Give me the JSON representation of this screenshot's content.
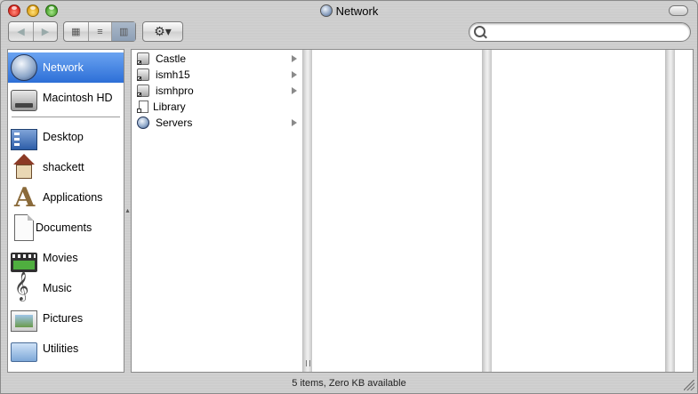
{
  "window": {
    "title": "Network"
  },
  "toolbar": {
    "back_glyph": "◀",
    "forward_glyph": "▶",
    "view_icon_glyph": "▦",
    "view_list_glyph": "≡",
    "view_column_glyph": "▥",
    "action_glyph": "⚙▾",
    "search_placeholder": ""
  },
  "sidebar": {
    "items": [
      {
        "label": "Network",
        "icon": "network-globe-icon",
        "selected": true
      },
      {
        "label": "Macintosh HD",
        "icon": "hard-drive-icon"
      },
      {
        "label": "Desktop",
        "icon": "desktop-icon"
      },
      {
        "label": "shackett",
        "icon": "home-icon"
      },
      {
        "label": "Applications",
        "icon": "applications-icon"
      },
      {
        "label": "Documents",
        "icon": "documents-icon"
      },
      {
        "label": "Movies",
        "icon": "movies-icon"
      },
      {
        "label": "Music",
        "icon": "music-icon"
      },
      {
        "label": "Pictures",
        "icon": "pictures-icon"
      },
      {
        "label": "Utilities",
        "icon": "utilities-icon"
      }
    ]
  },
  "browser": {
    "column1": [
      {
        "label": "Castle",
        "icon": "server-alias-icon",
        "has_children": true
      },
      {
        "label": "ismh15",
        "icon": "server-alias-icon",
        "has_children": true
      },
      {
        "label": "ismhpro",
        "icon": "server-alias-icon",
        "has_children": true
      },
      {
        "label": "Library",
        "icon": "document-alias-icon",
        "has_children": false
      },
      {
        "label": "Servers",
        "icon": "network-globe-icon",
        "has_children": true
      }
    ]
  },
  "status": {
    "text": "5 items, Zero KB available"
  },
  "colors": {
    "selection": "#3a7ee0",
    "metal": "#cccccc"
  }
}
